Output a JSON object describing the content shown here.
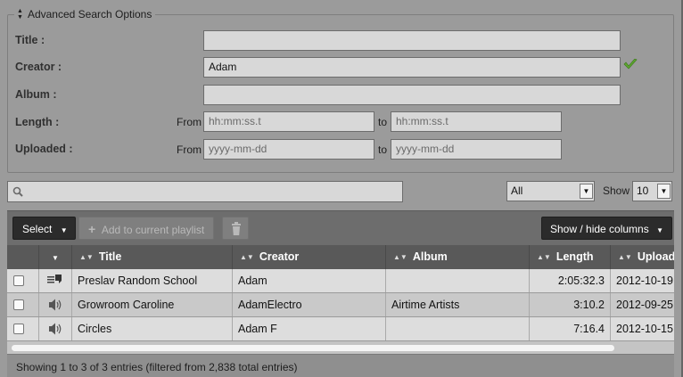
{
  "advanced_search": {
    "legend": "Advanced Search Options",
    "fields": {
      "title": {
        "label": "Title :",
        "value": ""
      },
      "creator": {
        "label": "Creator :",
        "value": "Adam"
      },
      "album": {
        "label": "Album :",
        "value": ""
      },
      "length": {
        "label": "Length :",
        "from_label": "From",
        "to_label": "to",
        "from_placeholder": "hh:mm:ss.t",
        "to_placeholder": "hh:mm:ss.t"
      },
      "uploaded": {
        "label": "Uploaded :",
        "from_label": "From",
        "to_label": "to",
        "from_placeholder": "yyyy-mm-dd",
        "to_placeholder": "yyyy-mm-dd"
      }
    }
  },
  "search": {
    "value": ""
  },
  "filter": {
    "selected": "All"
  },
  "show": {
    "label": "Show",
    "selected": "10"
  },
  "toolbar": {
    "select_label": "Select",
    "add_label": "Add to current playlist",
    "show_hide_label": "Show / hide columns"
  },
  "table": {
    "columns": [
      "Title",
      "Creator",
      "Album",
      "Length",
      "Uploaded"
    ],
    "rows": [
      {
        "type_icon": "podcast-icon",
        "title": "Preslav Random School",
        "creator": "Adam",
        "album": "",
        "length": "2:05:32.3",
        "uploaded": "2012-10-19"
      },
      {
        "type_icon": "speaker-icon",
        "title": "Growroom Caroline",
        "creator": "AdamElectro",
        "album": "Airtime Artists",
        "length": "3:10.2",
        "uploaded": "2012-09-25"
      },
      {
        "type_icon": "speaker-icon",
        "title": "Circles",
        "creator": "Adam F",
        "album": "",
        "length": "7:16.4",
        "uploaded": "2012-10-15"
      }
    ]
  },
  "footer": {
    "info": "Showing 1 to 3 of 3 entries (filtered from 2,838 total entries)"
  },
  "colors": {
    "background": "#9b9b9b",
    "header": "#595959",
    "toolbar": "#6d6d6d",
    "valid_check": "#5fa830"
  }
}
